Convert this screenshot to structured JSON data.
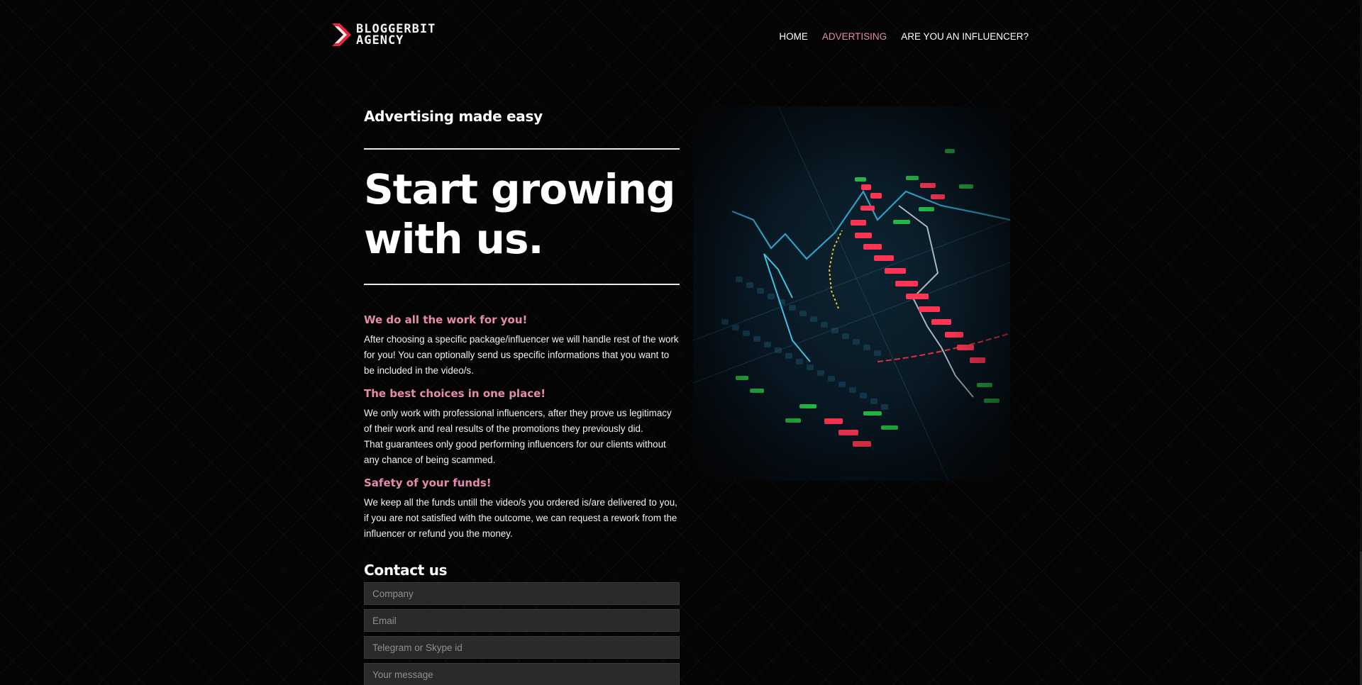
{
  "brand": {
    "name_line1": "BLOGGERBIT",
    "name_line2": "AGENCY",
    "accent_color": "#e8263f"
  },
  "nav": {
    "items": [
      {
        "label": "HOME",
        "active": false
      },
      {
        "label": "ADVERTISING",
        "active": true
      },
      {
        "label": "ARE YOU AN INFLUENCER?",
        "active": false
      }
    ],
    "active_color": "#e58bb0"
  },
  "main": {
    "eyebrow": "Advertising made easy",
    "hero_title": "Start growing with us.",
    "features": [
      {
        "title": "We do all the work for you!",
        "paragraphs": [
          "After choosing a specific package/influencer we will handle rest of the work for you! You can optionally send us specific informations that you want to be included in the video/s."
        ]
      },
      {
        "title": "The best choices in one place!",
        "paragraphs": [
          "We only work with professional influencers, after they prove us legitimacy of their work and real results of the promotions they previously did.",
          "That guarantees only good performing influencers for our clients without any chance of being scammed."
        ]
      },
      {
        "title": "Safety of your funds!",
        "paragraphs": [
          "We keep all the funds untill the video/s you ordered is/are delivered to you, if you are not satisfied with the outcome, we can request a rework from the influencer or refund you the money."
        ]
      }
    ]
  },
  "contact": {
    "title": "Contact us",
    "company_placeholder": "Company",
    "email_placeholder": "Email",
    "messenger_placeholder": "Telegram or Skype id",
    "message_placeholder": "Your message"
  }
}
